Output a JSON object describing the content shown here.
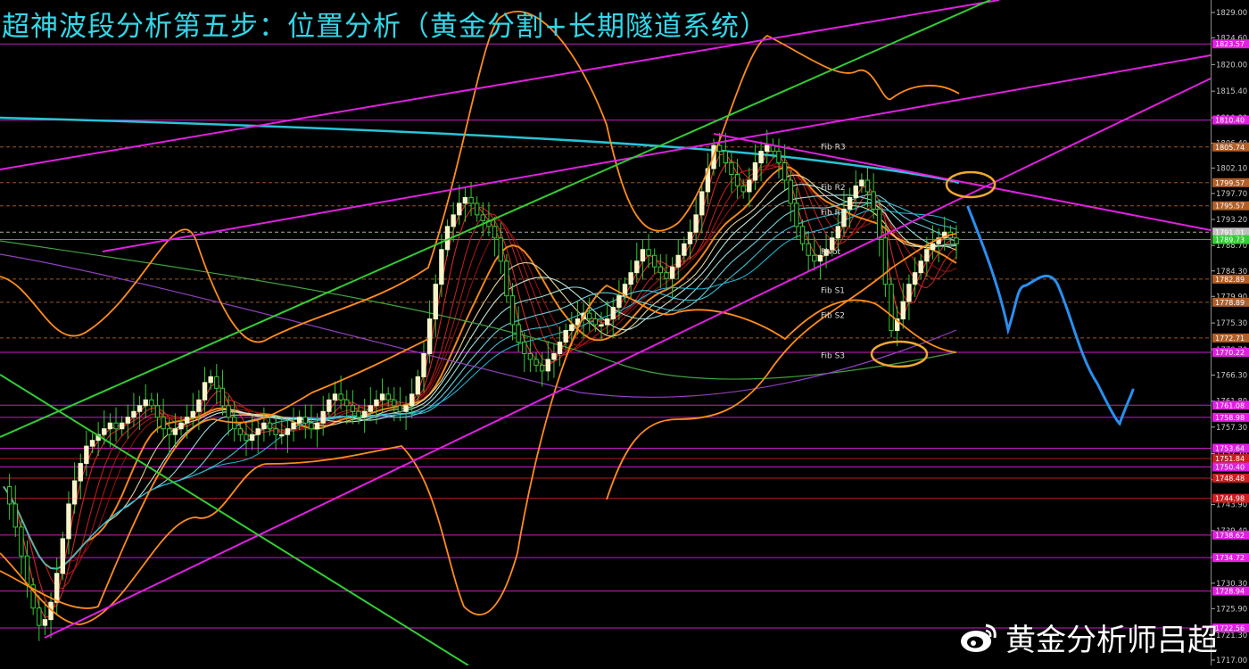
{
  "title": "超神波段分析第五步：位置分析（黄金分割+长期隧道系统）",
  "watermark": "黄金分析师吕超",
  "colors": {
    "background": "#000000",
    "title": "#33d6e8",
    "channel": "#e020e0",
    "trend_green": "#33cc33",
    "long_ma": "#29c3d6",
    "bollinger": "#ff8c1a",
    "forecast": "#2a8ff0",
    "highlight": "#f0a830"
  },
  "chart_data": {
    "type": "candlestick",
    "price_axis": {
      "ylim": [
        1717.0,
        1829.0
      ],
      "tick_labels": [
        "1829.00",
        "1824.60",
        "1820.00",
        "1815.40",
        "1810.80",
        "1806.40",
        "1802.10",
        "1797.70",
        "1793.20",
        "1788.70",
        "1784.30",
        "1779.90",
        "1775.30",
        "1770.70",
        "1766.30",
        "1761.80",
        "1757.30",
        "1752.70",
        "1748.20",
        "1743.90",
        "1739.40",
        "1734.80",
        "1730.30",
        "1725.90",
        "1721.30",
        "1717.00"
      ]
    },
    "horizontal_levels": [
      {
        "value": 1823.57,
        "label": "1823.57",
        "color": "#e020e0"
      },
      {
        "value": 1810.4,
        "label": "1810.40",
        "color": "#e020e0"
      },
      {
        "value": 1805.74,
        "label": "1805.74",
        "color": "#b0602a"
      },
      {
        "value": 1799.57,
        "label": "1799.57",
        "color": "#b0602a"
      },
      {
        "value": 1795.57,
        "label": "1795.57",
        "color": "#b0602a"
      },
      {
        "value": 1791.01,
        "label": "1791.01",
        "color": "#c0c0c0"
      },
      {
        "value": 1789.73,
        "label": "1789.73",
        "color": "#33cc33"
      },
      {
        "value": 1782.89,
        "label": "1782.89",
        "color": "#b0602a"
      },
      {
        "value": 1778.89,
        "label": "1778.89",
        "color": "#b0602a"
      },
      {
        "value": 1772.71,
        "label": "1772.71",
        "color": "#b0602a"
      },
      {
        "value": 1770.22,
        "label": "1770.22",
        "color": "#e020e0"
      },
      {
        "value": 1761.08,
        "label": "1761.08",
        "color": "#e020e0"
      },
      {
        "value": 1758.98,
        "label": "1758.98",
        "color": "#e020e0"
      },
      {
        "value": 1753.64,
        "label": "1753.64",
        "color": "#e020e0"
      },
      {
        "value": 1751.84,
        "label": "1751.84",
        "color": "#cc2020"
      },
      {
        "value": 1750.4,
        "label": "1750.40",
        "color": "#e020e0"
      },
      {
        "value": 1748.48,
        "label": "1748.48",
        "color": "#cc2020"
      },
      {
        "value": 1744.98,
        "label": "1744.98",
        "color": "#cc2020"
      },
      {
        "value": 1738.62,
        "label": "1738.62",
        "color": "#e020e0"
      },
      {
        "value": 1734.72,
        "label": "1734.72",
        "color": "#e020e0"
      },
      {
        "value": 1728.94,
        "label": "1728.94",
        "color": "#e020e0"
      },
      {
        "value": 1722.56,
        "label": "1722.56",
        "color": "#e020e0"
      }
    ],
    "pivot_labels": [
      {
        "label": "Fib R3",
        "value": 1805.3
      },
      {
        "label": "Fib R2",
        "value": 1798.3
      },
      {
        "label": "Fib R1",
        "value": 1794.0
      },
      {
        "label": "Pivot",
        "value": 1787.2
      },
      {
        "label": "Fib S1",
        "value": 1780.5
      },
      {
        "label": "Fib S2",
        "value": 1776.2
      },
      {
        "label": "Fib S3",
        "value": 1769.2
      }
    ],
    "close_series": [
      1747,
      1744,
      1740,
      1735,
      1730,
      1726,
      1723,
      1724,
      1727,
      1732,
      1738,
      1744,
      1748,
      1751,
      1754,
      1755,
      1756,
      1757,
      1758,
      1757,
      1758,
      1759,
      1760,
      1761,
      1762,
      1761,
      1759,
      1757,
      1756,
      1757,
      1758,
      1759,
      1760,
      1762,
      1765,
      1766,
      1764,
      1761,
      1759,
      1757,
      1756,
      1755,
      1756,
      1757,
      1758,
      1757,
      1756,
      1756,
      1757,
      1758,
      1759,
      1758,
      1757,
      1758,
      1760,
      1762,
      1763,
      1762,
      1761,
      1760,
      1759,
      1760,
      1761,
      1762,
      1763,
      1762,
      1761,
      1760,
      1761,
      1763,
      1766,
      1770,
      1776,
      1782,
      1788,
      1792,
      1794,
      1796,
      1797,
      1796,
      1794,
      1793,
      1792,
      1790,
      1786,
      1780,
      1775,
      1772,
      1770,
      1769,
      1768,
      1767,
      1769,
      1770,
      1772,
      1774,
      1775,
      1776,
      1777,
      1776,
      1775,
      1775,
      1776,
      1778,
      1780,
      1782,
      1784,
      1786,
      1788,
      1787,
      1785,
      1784,
      1783,
      1785,
      1787,
      1789,
      1791,
      1794,
      1798,
      1802,
      1806,
      1805,
      1803,
      1801,
      1799,
      1798,
      1800,
      1803,
      1805,
      1806,
      1805,
      1803,
      1800,
      1796,
      1792,
      1789,
      1787,
      1786,
      1787,
      1788,
      1790,
      1792,
      1795,
      1797,
      1799,
      1800,
      1798,
      1795,
      1790,
      1782,
      1774,
      1776,
      1779,
      1782,
      1784,
      1786,
      1788,
      1789,
      1790,
      1791,
      1790,
      1789
    ]
  }
}
